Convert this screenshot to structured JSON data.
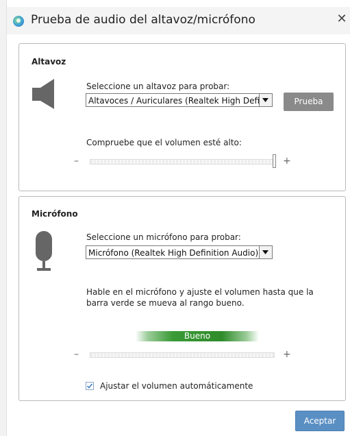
{
  "window": {
    "title": "Prueba de audio del altavoz/micrófono",
    "close_glyph": "✕",
    "icon": "app-logo-icon"
  },
  "speaker": {
    "section_title": "Altavoz",
    "icon": "speaker-icon",
    "select_label": "Seleccione un altavoz para probar:",
    "selected_device": "Altavoces / Auriculares (Realtek High Definition Audio)",
    "test_button": "Prueba",
    "volume_label": "Compruebe que el volumen esté alto:",
    "volume_level": 1.0,
    "minus": "–",
    "plus": "+"
  },
  "microphone": {
    "section_title": "Micrófono",
    "icon": "microphone-icon",
    "select_label": "Seleccione un micrófono para probar:",
    "selected_device": "Micrófono (Realtek High Definition Audio)",
    "instructions_line1": "Hable en el micrófono y ajuste el volumen hasta que la",
    "instructions_line2": "barra verde se mueva al rango bueno.",
    "level_label": "Bueno",
    "minus": "–",
    "plus": "+",
    "auto_adjust_label": "Ajustar el volumen automáticamente",
    "auto_adjust_checked": true
  },
  "footer": {
    "accept_button": "Aceptar"
  },
  "colors": {
    "accent_button": "#5a8fc3",
    "secondary_button": "#8a8a8a",
    "level_green": "#2f8c2b"
  }
}
